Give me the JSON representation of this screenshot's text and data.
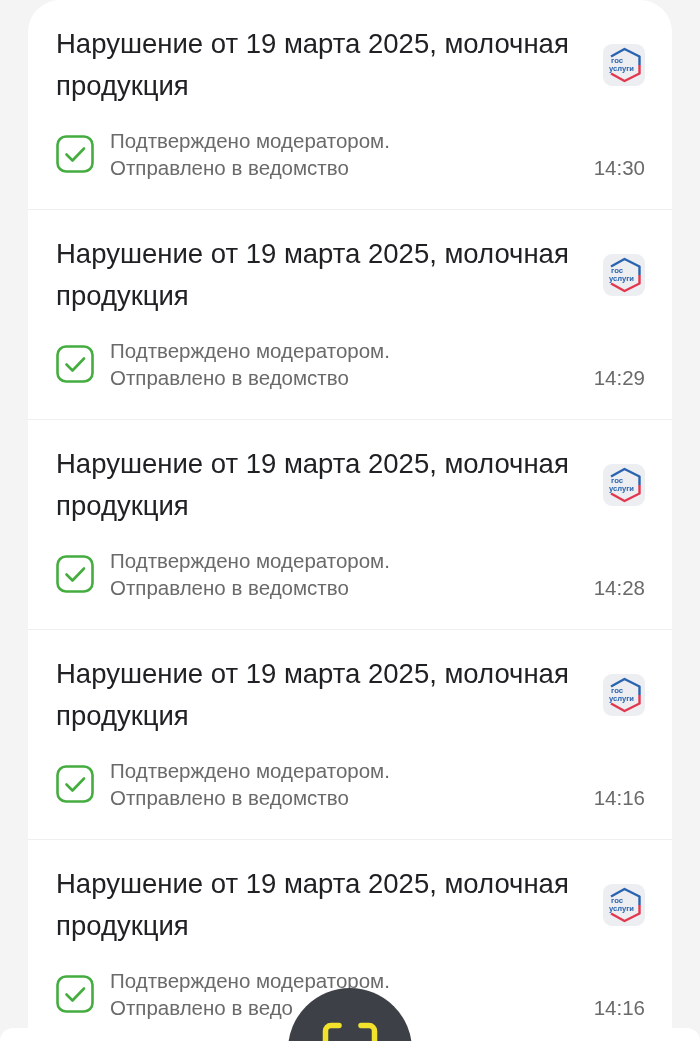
{
  "items": [
    {
      "title": "Нарушение от 19 марта 2025, молочная продукция",
      "logo_text": [
        "гос",
        "услуги"
      ],
      "status": "Подтверждено модератором.",
      "detail": "Отправлено в ведомство",
      "time": "14:30"
    },
    {
      "title": "Нарушение от 19 марта 2025, молочная продукция",
      "logo_text": [
        "гос",
        "услуги"
      ],
      "status": "Подтверждено модератором.",
      "detail": "Отправлено в ведомство",
      "time": "14:29"
    },
    {
      "title": "Нарушение от 19 марта 2025, молочная продукция",
      "logo_text": [
        "гос",
        "услуги"
      ],
      "status": "Подтверждено модератором.",
      "detail": "Отправлено в ведомство",
      "time": "14:28"
    },
    {
      "title": "Нарушение от 19 марта 2025, молочная продукция",
      "logo_text": [
        "гос",
        "услуги"
      ],
      "status": "Подтверждено модератором.",
      "detail": "Отправлено в ведомство",
      "time": "14:16"
    },
    {
      "title": "Нарушение от 19 марта 2025, молочная продукция",
      "logo_text": [
        "гос",
        "услуги"
      ],
      "status": "Подтверждено модератором.",
      "detail": "Отправлено в ведо",
      "time": "14:16"
    }
  ]
}
